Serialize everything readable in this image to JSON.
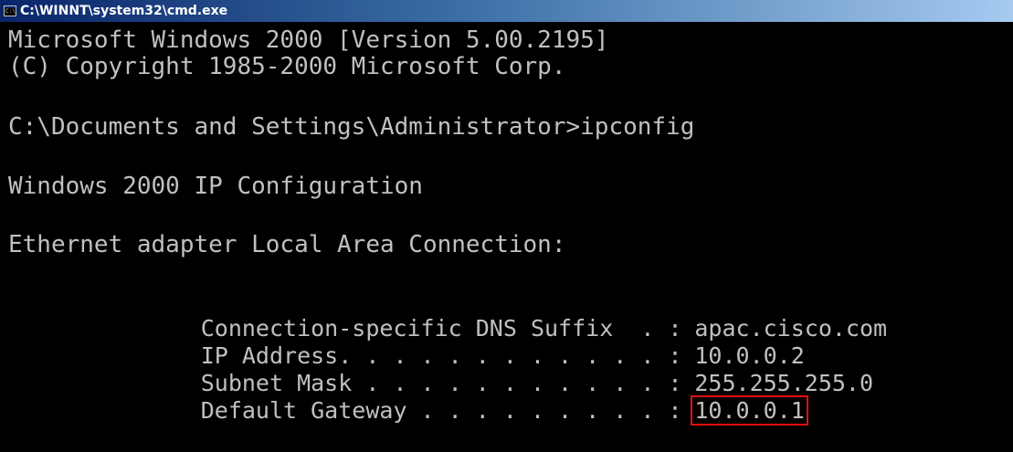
{
  "window": {
    "title": "C:\\WINNT\\system32\\cmd.exe"
  },
  "console": {
    "lines": [
      "Microsoft Windows 2000 [Version 5.00.2195]",
      "(C) Copyright 1985-2000 Microsoft Corp.",
      "C:\\Documents and Settings\\Administrator>ipconfig",
      "Windows 2000 IP Configuration",
      "Ethernet adapter Local Area Connection:"
    ],
    "details": [
      {
        "label": "        Connection-specific DNS Suffix  . :",
        "value": " apac.cisco.com"
      },
      {
        "label": "        IP Address. . . . . . . . . . . . :",
        "value": " 10.0.0.2"
      },
      {
        "label": "        Subnet Mask . . . . . . . . . . . :",
        "value": " 255.255.255.0"
      },
      {
        "label": "        Default Gateway . . . . . . . . . :",
        "value": "10.0.0.1"
      }
    ]
  },
  "colors": {
    "background": "#000000",
    "text": "#c0c0c0",
    "highlight_border": "#e01010"
  }
}
